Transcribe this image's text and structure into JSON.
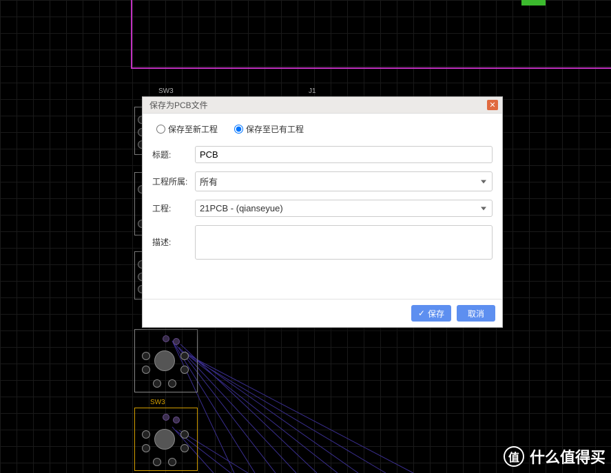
{
  "dialog": {
    "title": "保存为PCB文件",
    "radio_new": "保存至新工程",
    "radio_existing": "保存至已有工程",
    "label_title": "标题:",
    "label_owner": "工程所属:",
    "label_project": "工程:",
    "label_desc": "描述:",
    "value_title": "PCB",
    "value_owner": "所有",
    "value_project": "21PCB - (qianseyue)",
    "value_desc": "",
    "btn_save": "保存",
    "btn_cancel": "取消"
  },
  "components": {
    "sw3_top": "SW3",
    "j1": "J1",
    "sw3_bottom": "SW3"
  },
  "watermark": {
    "badge": "值",
    "text": "什么值得买"
  }
}
